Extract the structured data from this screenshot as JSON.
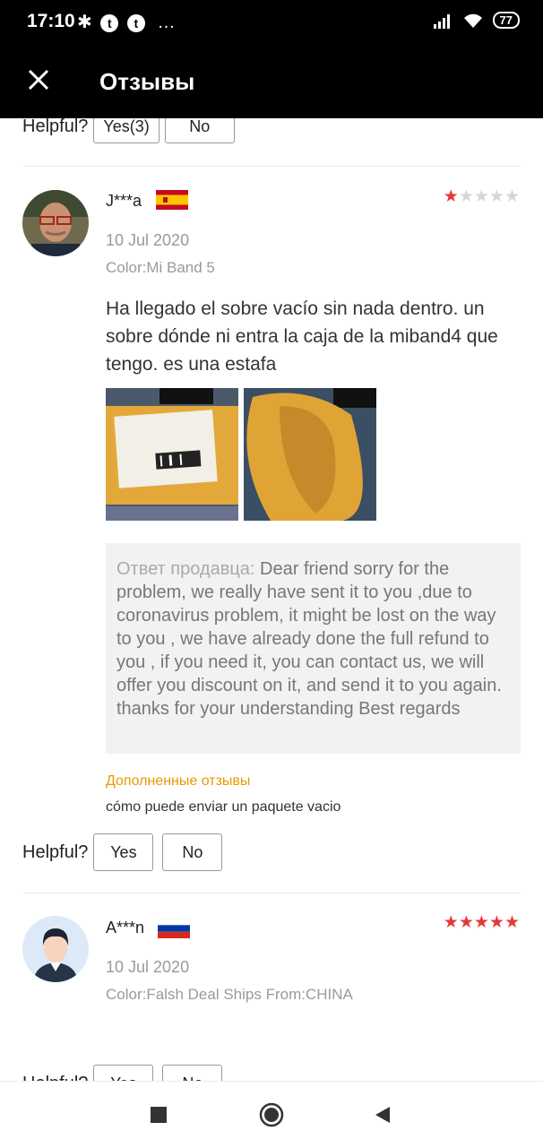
{
  "status_bar": {
    "time": "17:10",
    "battery": "77"
  },
  "app_bar": {
    "title": "Отзывы"
  },
  "helpful_label": "Helpful?",
  "prev_review": {
    "yes_label": "Yes(3)",
    "no_label": "No"
  },
  "reviews": [
    {
      "author": "J***a",
      "country": "Spain",
      "rating": 1,
      "date": "10 Jul 2020",
      "color": "Color:Mi Band 5",
      "text": "Ha llegado el sobre vacío sin nada dentro. un sobre dónde ni entra la caja de la miband4 que tengo. es una estafa",
      "seller_reply_label": "Ответ продавца:",
      "seller_reply": " Dear friend sorry for the problem, we really have sent it to you ,due to coronavirus problem, it might be lost on the way to you , we have already done the full refund to you , if you need it, you can contact us, we will offer you discount on it, and send it to you again. thanks for your understanding Best regards",
      "additional_label": "Дополненные отзывы",
      "additional_text": "cómo puede enviar un paquete vacio",
      "yes_label": "Yes",
      "no_label": "No"
    },
    {
      "author": "A***n",
      "country": "Russia",
      "rating": 5,
      "date": "10 Jul 2020",
      "color": "Color:Falsh Deal Ships From:CHINA",
      "yes_label": "Yes",
      "no_label": "No"
    }
  ],
  "colors": {
    "star_filled": "#e53935",
    "star_empty": "#d6d6d6",
    "accent_orange": "#e69a00"
  },
  "icons": [
    "close-icon",
    "bluetooth-icon",
    "app-t-icon",
    "signal-icon",
    "wifi-icon",
    "stop-icon",
    "home-icon",
    "back-icon"
  ]
}
